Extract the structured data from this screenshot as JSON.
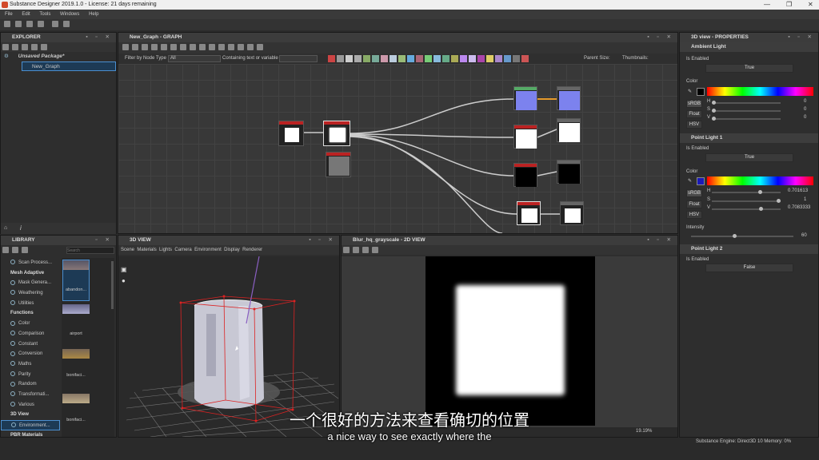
{
  "window": {
    "title": "Substance Designer 2019.1.0 - License: 21 days remaining"
  },
  "menu": [
    "File",
    "Edit",
    "Tools",
    "Windows",
    "Help"
  ],
  "explorer": {
    "title": "EXPLORER",
    "package": "Unsaved Package*",
    "graph": "New_Graph"
  },
  "graph": {
    "title": "New_Graph - GRAPH",
    "filter_label": "Filter by Node Type",
    "filter_value": "All",
    "containing_label": "Containing text or variable",
    "parent_size_label": "Parent Size:",
    "thumbnails_label": "Thumbnails:"
  },
  "library": {
    "title": "LIBRARY",
    "search_placeholder": "Search",
    "items": [
      {
        "type": "row",
        "label": "Scan Process..."
      },
      {
        "type": "cat",
        "label": "Mesh Adaptive"
      },
      {
        "type": "row",
        "label": "Mask Genera..."
      },
      {
        "type": "row",
        "label": "Weathering"
      },
      {
        "type": "row",
        "label": "Utilities"
      },
      {
        "type": "cat",
        "label": "Functions"
      },
      {
        "type": "row",
        "label": "Color"
      },
      {
        "type": "row",
        "label": "Comparison"
      },
      {
        "type": "row",
        "label": "Constant"
      },
      {
        "type": "row",
        "label": "Conversion"
      },
      {
        "type": "row",
        "label": "Maths"
      },
      {
        "type": "row",
        "label": "Parity"
      },
      {
        "type": "row",
        "label": "Random"
      },
      {
        "type": "row",
        "label": "Transformati..."
      },
      {
        "type": "row",
        "label": "Various"
      },
      {
        "type": "cat",
        "label": "3D View"
      },
      {
        "type": "row",
        "label": "Environment..."
      },
      {
        "type": "cat",
        "label": "PBR Materials"
      }
    ],
    "thumbs": [
      "abandon...",
      "airport",
      "bonifaci...",
      "bonifaci..."
    ]
  },
  "view3d": {
    "title": "3D VIEW",
    "menu": [
      "Scene",
      "Materials",
      "Lights",
      "Camera",
      "Environment",
      "Display",
      "Renderer"
    ]
  },
  "view2d": {
    "title": "Blur_hq_grayscale - 2D VIEW",
    "zoom": "19.19%"
  },
  "properties": {
    "title": "3D view - PROPERTIES",
    "ambient": {
      "title": "Ambient Light",
      "enabled_label": "Is Enabled",
      "enabled": "True",
      "color_label": "Color",
      "h": "0",
      "s": "0",
      "v": "0"
    },
    "point1": {
      "title": "Point Light 1",
      "enabled_label": "Is Enabled",
      "enabled": "True",
      "color_label": "Color",
      "h": "0.701613",
      "s": "1",
      "v": "0.7083333",
      "intensity_label": "Intensity",
      "intensity": "60"
    },
    "point2": {
      "title": "Point Light 2",
      "enabled_label": "Is Enabled",
      "enabled": "False"
    },
    "mode_srgb": "sRGB",
    "mode_float": "Float",
    "mode_hsv": "HSV",
    "h_label": "H",
    "s_label": "S",
    "v_label": "V"
  },
  "status": {
    "engine": "Substance Engine: Direct3D 10  Memory: 0%"
  },
  "subtitles": {
    "cn": "一个很好的方法来查看确切的位置",
    "en": "a nice way to see exactly where the"
  }
}
